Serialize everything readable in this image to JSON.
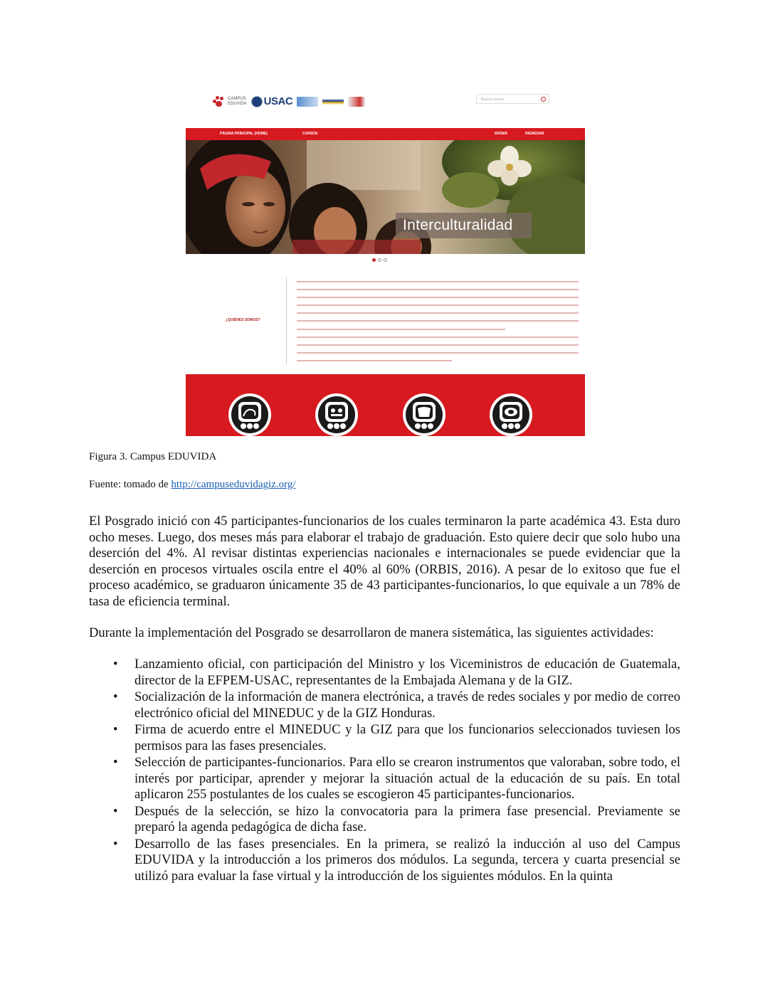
{
  "figure": {
    "header": {
      "logo_campus_line1": "CAMPUS",
      "logo_campus_line2": "EDUVIDA",
      "logo_usac": "USAC",
      "search_placeholder": "Buscar cursos"
    },
    "nav": {
      "home": "PÁGINA PRINCIPAL (HOME)",
      "courses": "CURSOS",
      "language": "IDIOMA",
      "login": "INGRESAR"
    },
    "hero_banner": "Interculturalidad",
    "about_title": "¿QUIÉNES SOMOS?"
  },
  "caption_figure": "Figura 3. Campus EDUVIDA",
  "caption_source_prefix": "Fuente: tomado de ",
  "caption_source_link": "http://campuseduvidagiz.org/",
  "paragraph1": "El Posgrado inició con 45 participantes-funcionarios de los cuales terminaron la parte académica 43. Esta duro ocho meses. Luego, dos meses más para elaborar el trabajo de graduación. Esto quiere decir que solo hubo una deserción del 4%. Al revisar distintas experiencias nacionales e internacionales se puede evidenciar que la deserción en procesos virtuales oscila entre el 40% al 60% (ORBIS, 2016). A pesar de lo exitoso que fue el proceso académico, se graduaron únicamente 35 de 43 participantes-funcionarios, lo que equivale a un 78% de tasa de eficiencia terminal.",
  "paragraph2": "Durante la implementación del Posgrado se desarrollaron de manera sistemática, las siguientes actividades:",
  "bullet_symbol": "•",
  "bullets": [
    "Lanzamiento oficial, con participación del Ministro y los Viceministros de educación de Guatemala, director de la EFPEM-USAC, representantes de la Embajada Alemana y de la GIZ.",
    "Socialización de la información de manera electrónica, a través de redes sociales y por medio de correo electrónico oficial del MINEDUC y de la GIZ Honduras.",
    "Firma de acuerdo entre el MINEDUC y la GIZ para que los funcionarios seleccionados tuviesen los permisos para las fases presenciales.",
    "Selección de participantes-funcionarios. Para ello se crearon instrumentos que valoraban, sobre todo, el interés por participar, aprender y mejorar la situación actual de la educación de su país. En total aplicaron 255 postulantes de los cuales se escogieron 45 participantes-funcionarios.",
    "Después de la selección, se hizo la convocatoria para la primera fase presencial. Previamente se preparó la agenda pedagógica de dicha fase.",
    "Desarrollo de las fases presenciales. En la primera, se realizó la inducción al uso del Campus EDUVIDA y la introducción a los primeros dos módulos. La segunda, tercera y cuarta presencial se utilizó para evaluar la fase virtual y la introducción de los siguientes módulos. En la quinta"
  ]
}
